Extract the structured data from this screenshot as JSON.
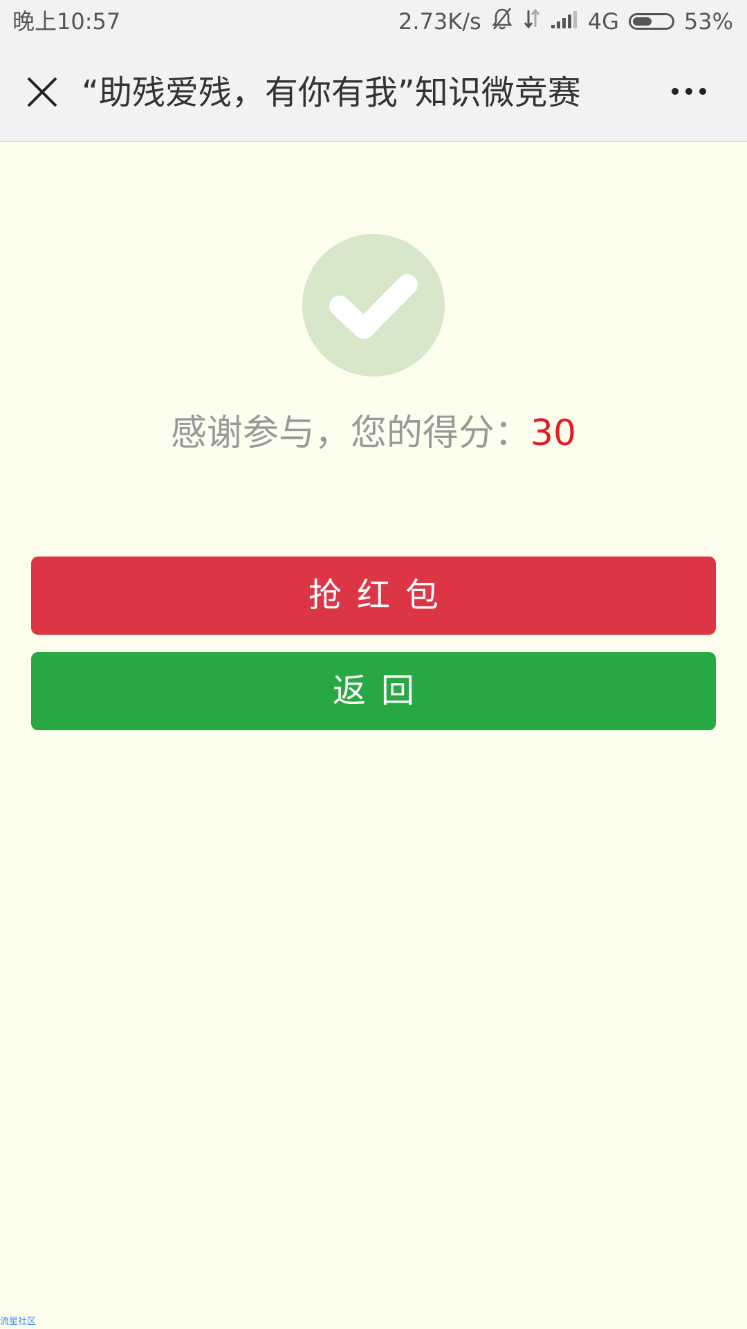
{
  "status_bar": {
    "time": "晚上10:57",
    "speed": "2.73K/s",
    "network": "4G",
    "battery_percent": "53%",
    "battery_level": 0.53,
    "icons": [
      "bell-muted-icon",
      "data-arrows-icon",
      "signal-icon",
      "battery-icon"
    ]
  },
  "header": {
    "title": "“助残爱残，有你有我”知识微竞赛",
    "close_icon": "close-icon",
    "more_icon": "more-icon"
  },
  "result": {
    "icon": "check-icon",
    "label": "感谢参与，您的得分：",
    "score": "30"
  },
  "buttons": {
    "red_packet": "抢红包",
    "back": "返回"
  },
  "watermark": "流星社区",
  "colors": {
    "background": "#fefeee",
    "bar": "#f2f2f2",
    "score": "#e51c23",
    "red_button": "#dc3545",
    "green_button": "#28a745",
    "check_circle": "#d6e8c9"
  }
}
